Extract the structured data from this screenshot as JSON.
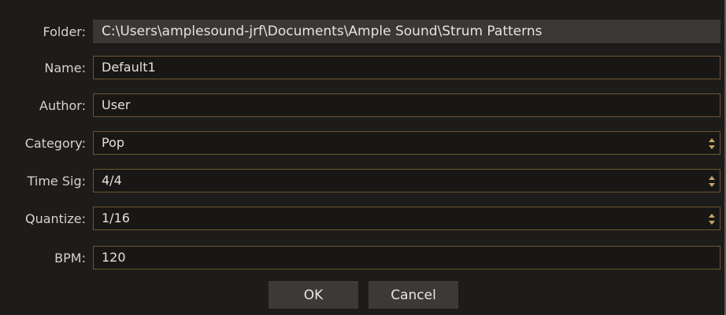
{
  "folder": {
    "label": "Folder:",
    "value": "C:\\Users\\amplesound-jrf\\Documents\\Ample Sound\\Strum Patterns"
  },
  "name": {
    "label": "Name:",
    "value": "Default1"
  },
  "author": {
    "label": "Author:",
    "value": "User"
  },
  "category": {
    "label": "Category:",
    "value": "Pop",
    "icon": "spinner-arrows-icon"
  },
  "time_sig": {
    "label": "Time Sig:",
    "value": "4/4",
    "icon": "spinner-arrows-icon"
  },
  "quantize": {
    "label": "Quantize:",
    "value": "1/16",
    "icon": "spinner-arrows-icon"
  },
  "bpm": {
    "label": "BPM:",
    "value": "120"
  },
  "buttons": {
    "ok": "OK",
    "cancel": "Cancel"
  },
  "colors": {
    "accent_border": "#6e5630",
    "spinner": "#c9a467",
    "background": "#1d1c1a"
  }
}
